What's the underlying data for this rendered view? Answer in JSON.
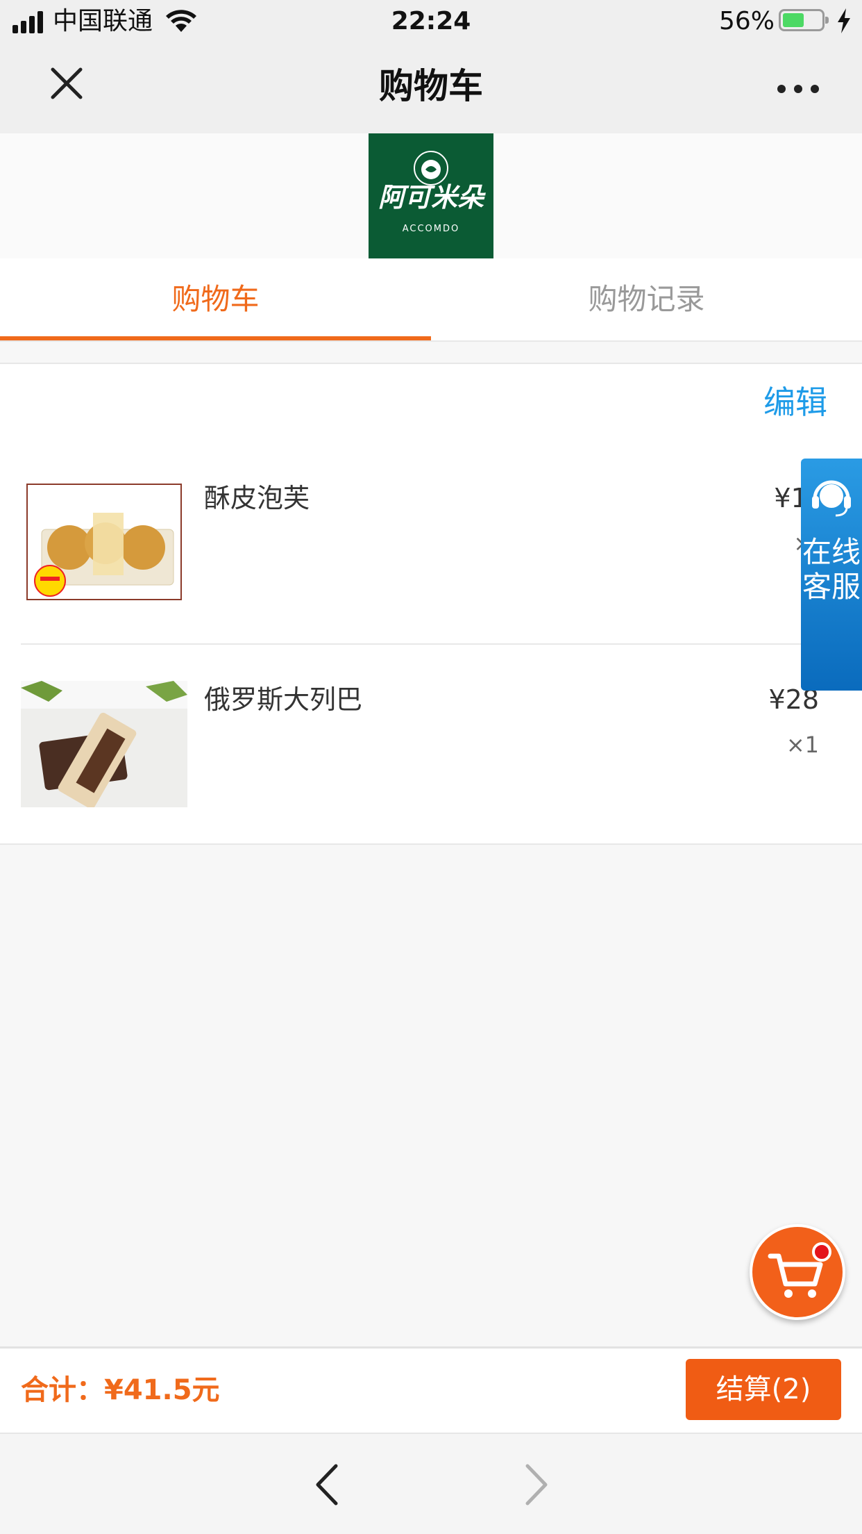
{
  "status_bar": {
    "carrier": "中国联通",
    "time": "22:24",
    "battery_percent": "56%",
    "icons": [
      "signal-icon",
      "wifi-icon",
      "battery-icon",
      "charging-bolt-icon"
    ]
  },
  "nav": {
    "title": "购物车",
    "close_icon": "close-icon",
    "more_icon": "more-dots-icon"
  },
  "brand": {
    "logo_text": "阿可米朵",
    "logo_subtext": "ACCOMDO",
    "logo_color": "#0b5b34"
  },
  "tabs": [
    {
      "label": "购物车",
      "active": true
    },
    {
      "label": "购物记录",
      "active": false
    }
  ],
  "cart": {
    "edit_label": "编辑",
    "items": [
      {
        "name": "酥皮泡芙",
        "price": "¥13.",
        "qty": "×"
      },
      {
        "name": "俄罗斯大列巴",
        "price": "¥28",
        "qty": "×1"
      }
    ]
  },
  "service": {
    "label": "在线客服",
    "icon": "headset-icon"
  },
  "floating_cart": {
    "icon": "shopping-cart-icon",
    "has_badge": true
  },
  "summary": {
    "total_label": "合计：¥41.5元",
    "checkout_label": "结算(2)"
  },
  "browser_toolbar": {
    "back_icon": "chevron-left-icon",
    "forward_icon": "chevron-right-icon"
  },
  "colors": {
    "accent": "#f06a1b",
    "link": "#1e9be8",
    "service_blue": "#0a6bbd",
    "checkout": "#f05c14"
  }
}
